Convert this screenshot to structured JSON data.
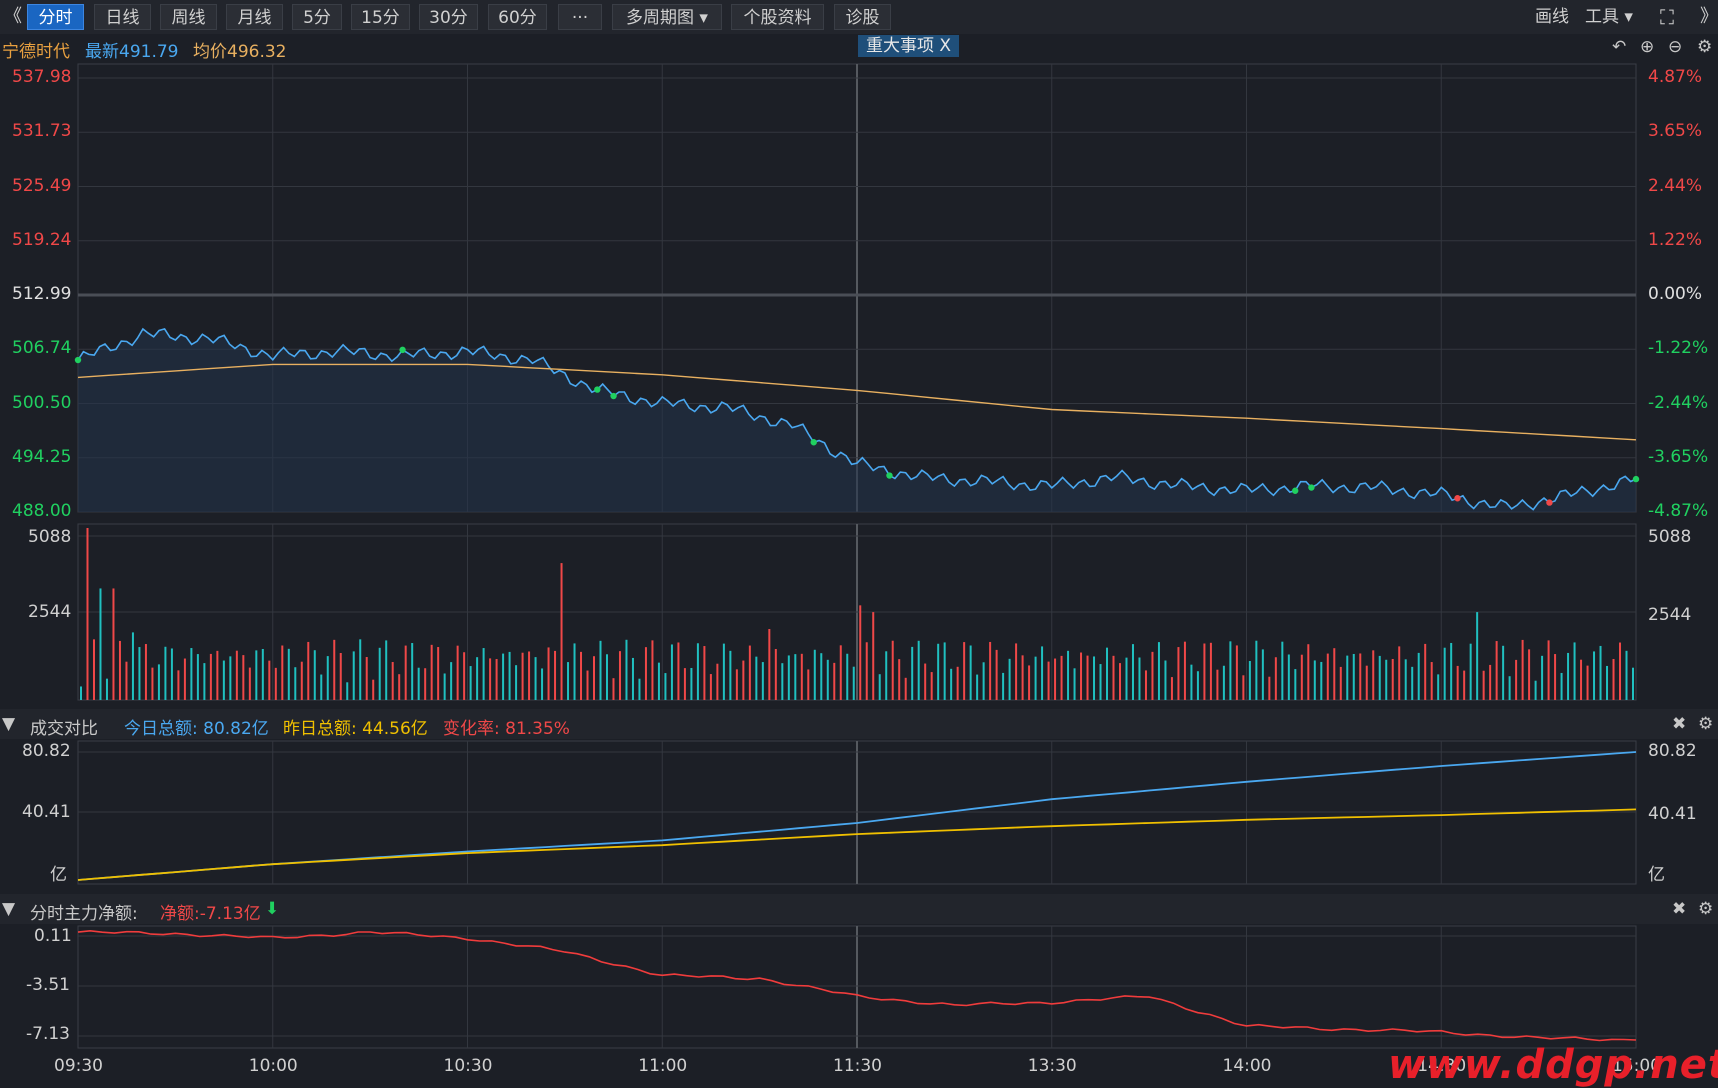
{
  "toolbar": {
    "back": "《",
    "tabs": [
      "分时",
      "日线",
      "周线",
      "月线",
      "5分",
      "15分",
      "30分",
      "60分",
      "···",
      "多周期图 ▾",
      "个股资料",
      "诊股"
    ],
    "draw": "画线",
    "tools": "工具 ▾",
    "forward": "》"
  },
  "stock": {
    "name": "宁德时代",
    "latest": "最新491.79",
    "avg": "均价496.32",
    "event_badge": "重大事项 X"
  },
  "price_axis": {
    "left": [
      "537.98",
      "531.73",
      "525.49",
      "519.24",
      "512.99",
      "506.74",
      "500.50",
      "494.25",
      "488.00"
    ],
    "right": [
      "4.87%",
      "3.65%",
      "2.44%",
      "1.22%",
      "0.00%",
      "-1.22%",
      "-2.44%",
      "-3.65%",
      "-4.87%"
    ]
  },
  "volume_axis": {
    "left": [
      "5088",
      "2544"
    ],
    "right": [
      "5088",
      "2544"
    ]
  },
  "compare_panel": {
    "title": "成交对比",
    "today": "今日总额: 80.82亿",
    "yesterday": "昨日总额: 44.56亿",
    "change": "变化率: 81.35%",
    "axis_left": [
      "80.82",
      "40.41",
      "亿"
    ],
    "axis_right": [
      "80.82",
      "40.41",
      "亿"
    ]
  },
  "net_panel": {
    "title": "分时主力净额:",
    "value": "净额:-7.13亿",
    "arrow": "⬇",
    "axis": [
      "0.11",
      "-3.51",
      "-7.13"
    ]
  },
  "time_axis": [
    "09:30",
    "10:00",
    "10:30",
    "11:00",
    "11:30",
    "13:30",
    "14:00",
    "14:30",
    "15:00"
  ],
  "watermark": "www.ddgp.net",
  "colors": {
    "price_line": "#4aa8f0",
    "avg_line": "#e8b060",
    "up": "#f04848",
    "down": "#20c0c0",
    "yesterday_line": "#f0c000",
    "net_line": "#f03c3c"
  },
  "chart_data": [
    {
      "type": "line",
      "title": "",
      "series": [
        {
          "name": "",
          "x": [
            "09:30",
            "09:40",
            "09:50",
            "10:00",
            "10:10",
            "10:20",
            "10:30",
            "10:40",
            "10:50",
            "11:00",
            "11:10",
            "11:20",
            "11:30",
            "13:10",
            "13:20",
            "13:30",
            "13:40",
            "13:50",
            "14:00",
            "14:10",
            "14:20",
            "14:30",
            "14:40",
            "14:50",
            "15:00"
          ],
          "values": [
            505.5,
            508.5,
            508.0,
            506.0,
            506.5,
            506.0,
            506.5,
            505.5,
            502.0,
            500.5,
            500.0,
            498.0,
            493.5,
            492.0,
            491.5,
            491.0,
            492.0,
            491.0,
            490.5,
            491.0,
            490.8,
            490.0,
            488.5,
            490.0,
            491.79
          ]
        },
        {
          "name": "均价",
          "x": [
            "09:30",
            "10:00",
            "10:30",
            "11:00",
            "11:30",
            "13:30",
            "14:00",
            "14:30",
            "15:00"
          ],
          "values": [
            503.5,
            505.0,
            505.0,
            503.8,
            502.0,
            499.8,
            498.8,
            497.6,
            496.32
          ]
        }
      ],
      "ylim": [
        488.0,
        537.98
      ]
    },
    {
      "type": "bar",
      "title": "",
      "ylim": [
        0,
        5088
      ]
    },
    {
      "type": "line",
      "title": "成交对比",
      "series": [
        {
          "name": "今日总额",
          "x": [
            "09:30",
            "10:00",
            "10:30",
            "11:00",
            "11:30",
            "13:30",
            "14:00",
            "14:30",
            "15:00"
          ],
          "values": [
            0,
            10,
            18,
            25,
            36,
            51,
            62,
            72,
            80.82
          ]
        },
        {
          "name": "昨日总额",
          "x": [
            "09:30",
            "10:00",
            "10:30",
            "11:00",
            "11:30",
            "13:30",
            "14:00",
            "14:30",
            "15:00"
          ],
          "values": [
            0,
            10,
            17,
            22,
            29,
            34,
            38,
            41,
            44.56
          ]
        }
      ],
      "ylim": [
        0,
        80.82
      ]
    },
    {
      "type": "line",
      "title": "分时主力净额",
      "series": [
        {
          "name": "",
          "x": [
            "09:30",
            "09:45",
            "10:00",
            "10:15",
            "10:30",
            "10:45",
            "11:00",
            "11:15",
            "11:30",
            "13:15",
            "13:30",
            "13:45",
            "14:00",
            "14:15",
            "14:30",
            "14:45",
            "15:00"
          ],
          "values": [
            0.1,
            0.0,
            -0.3,
            0.1,
            -0.3,
            -1.2,
            -2.8,
            -3.0,
            -4.2,
            -4.8,
            -4.6,
            -4.2,
            -6.2,
            -6.4,
            -6.6,
            -7.0,
            -7.13
          ]
        }
      ],
      "ylim": [
        -7.13,
        0.11
      ]
    }
  ]
}
